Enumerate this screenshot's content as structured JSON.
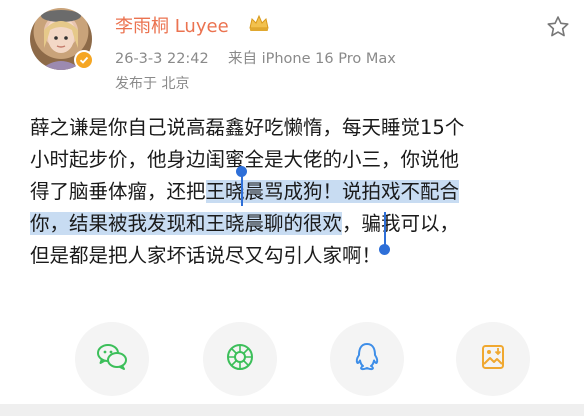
{
  "user": {
    "name": "李雨桐 Luyee",
    "timestamp": "26-3-3 22:42",
    "source": "来自 iPhone 16 Pro Max",
    "location": "发布于 北京"
  },
  "post": {
    "lines": [
      [
        {
          "text": "薛之谦是你自己说高磊鑫好吃懒惰，每天睡觉15个",
          "hl": false
        }
      ],
      [
        {
          "text": "小时起步价，他身边闺蜜全是大佬的小三，你说他",
          "hl": false
        }
      ],
      [
        {
          "text": "得了脑垂体瘤，还把",
          "hl": false
        },
        {
          "text": "王晓晨骂成狗！说拍戏不配合",
          "hl": true
        }
      ],
      [
        {
          "text": "你，结果被我发现和王晓晨聊的很欢",
          "hl": true
        },
        {
          "text": "，骗我可以，",
          "hl": false
        }
      ],
      [
        {
          "text": "但是都是把人家坏话说尽又勾引人家啊！",
          "hl": false
        }
      ]
    ]
  },
  "colors": {
    "username": "#eb7350",
    "meta": "#8a8a8a",
    "highlight": "#c8dcf2",
    "cursor": "#2e6fd8",
    "wechat": "#3cbf5a",
    "moments": "#3cbf5a",
    "qq": "#3e8ee8",
    "save": "#f0a830"
  },
  "icons": [
    "star-icon",
    "crown-icon",
    "verified-icon",
    "wechat-icon",
    "moments-icon",
    "qq-icon",
    "save-image-icon"
  ]
}
